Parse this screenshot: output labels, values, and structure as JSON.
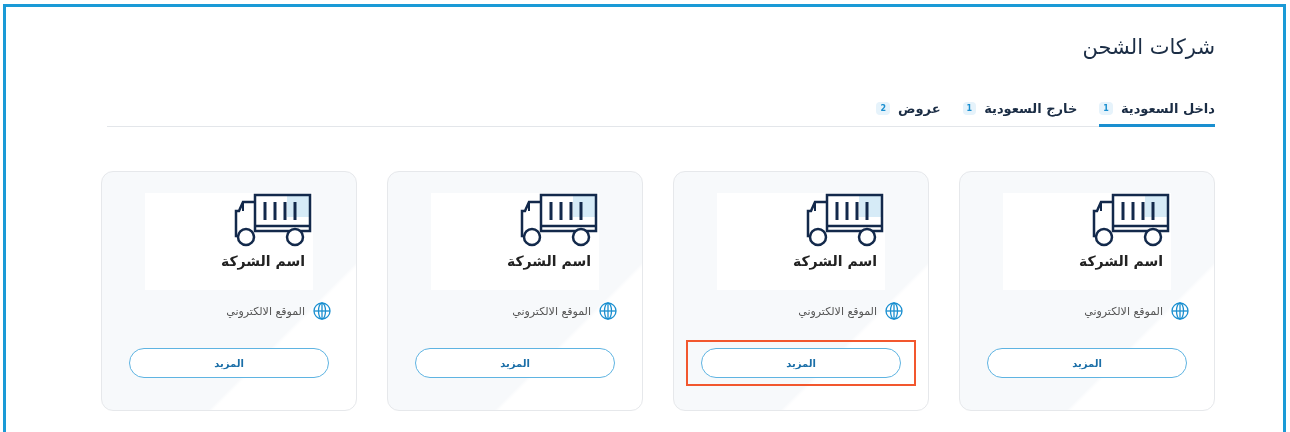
{
  "title": "شركات الشحن",
  "tabs": [
    {
      "label": "داخل السعودية",
      "count": "1",
      "selected": true
    },
    {
      "label": "خارج السعودية",
      "count": "1",
      "selected": false
    },
    {
      "label": "عروض",
      "count": "2",
      "selected": false
    }
  ],
  "cards": [
    {
      "name": "اسم الشركة",
      "website": "الموقع الالكتروني",
      "button": "المزيد",
      "highlighted": false
    },
    {
      "name": "اسم الشركة",
      "website": "الموقع الالكتروني",
      "button": "المزيد",
      "highlighted": true
    },
    {
      "name": "اسم الشركة",
      "website": "الموقع الالكتروني",
      "button": "المزيد",
      "highlighted": false
    },
    {
      "name": "اسم الشركة",
      "website": "الموقع الالكتروني",
      "button": "المزيد",
      "highlighted": false
    }
  ]
}
